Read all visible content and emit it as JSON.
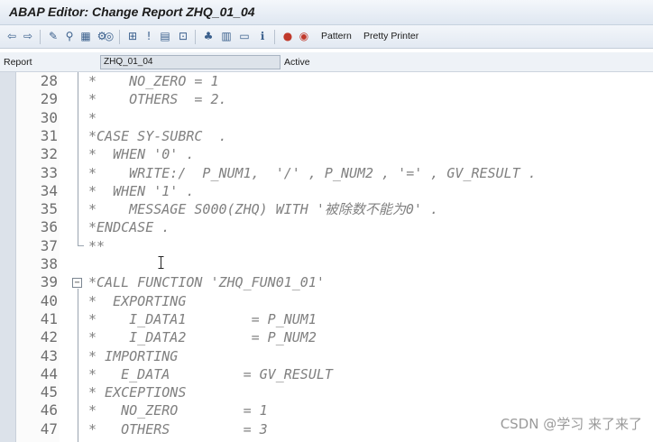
{
  "window": {
    "title": "ABAP Editor: Change Report ZHQ_01_04"
  },
  "toolbar": {
    "icons": [
      "back-arrow-icon",
      "forward-arrow-icon",
      "edit-toggle-icon",
      "other-object-icon",
      "check-icon",
      "activate-icon",
      "test-icon",
      "where-used-icon",
      "object-list-icon",
      "navigation-window-icon",
      "display-object-list-icon",
      "enhance-icon",
      "hierarchy-icon",
      "screen-icon",
      "info-icon",
      "breakpoint-icon",
      "session-breakpoint-icon"
    ],
    "pattern_label": "Pattern",
    "pretty_printer_label": "Pretty Printer"
  },
  "infobar": {
    "label": "Report",
    "program_name": "ZHQ_01_04",
    "status": "Active"
  },
  "editor": {
    "lines": [
      {
        "num": "28",
        "text": "*    NO_ZERO = 1"
      },
      {
        "num": "29",
        "text": "*    OTHERS  = 2."
      },
      {
        "num": "30",
        "text": "*"
      },
      {
        "num": "31",
        "text": "*CASE SY-SUBRC  ."
      },
      {
        "num": "32",
        "text": "*  WHEN '0' ."
      },
      {
        "num": "33",
        "text": "*    WRITE:/  P_NUM1,  '/' , P_NUM2 , '=' , GV_RESULT ."
      },
      {
        "num": "34",
        "text": "*  WHEN '1' ."
      },
      {
        "num": "35",
        "text": "*    MESSAGE S000(ZHQ) WITH '被除数不能为0' ."
      },
      {
        "num": "36",
        "text": "*ENDCASE ."
      },
      {
        "num": "37",
        "text": "**"
      },
      {
        "num": "38",
        "text": ""
      },
      {
        "num": "39",
        "text": "*CALL FUNCTION 'ZHQ_FUN01_01'"
      },
      {
        "num": "40",
        "text": "*  EXPORTING"
      },
      {
        "num": "41",
        "text": "*    I_DATA1        = P_NUM1"
      },
      {
        "num": "42",
        "text": "*    I_DATA2        = P_NUM2"
      },
      {
        "num": "43",
        "text": "* IMPORTING"
      },
      {
        "num": "44",
        "text": "*   E_DATA         = GV_RESULT"
      },
      {
        "num": "45",
        "text": "* EXCEPTIONS"
      },
      {
        "num": "46",
        "text": "*   NO_ZERO        = 1"
      },
      {
        "num": "47",
        "text": "*   OTHERS         = 3"
      }
    ]
  },
  "watermark": "CSDN @学习 来了来了"
}
